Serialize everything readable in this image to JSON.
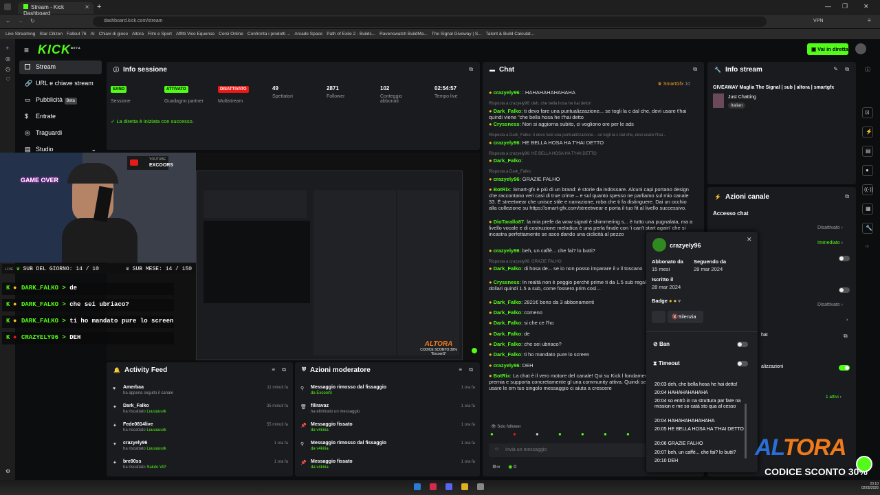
{
  "browser": {
    "tab_title": "Stream - Kick Dashboard",
    "url": "dashboard.kick.com/stream",
    "vpn": "VPN"
  },
  "bookmarks": [
    "Live Streaming",
    "Star Citizen",
    "Fallout 76",
    "AI",
    "Chiavi di gioco",
    "Altora",
    "Film e Sport",
    "Affitti Vico Equense",
    "Corsi Online",
    "Confronta i prodotti ...",
    "Arcade Space",
    "Path of Exile 2 - Builds...",
    "Ravenswatch BuildMa...",
    "The Signal Giveway | S...",
    "Talent & Build Calculat..."
  ],
  "header": {
    "logo": "KICK",
    "beta": "BETA",
    "go_live": "Vai in diretta"
  },
  "sidebar": {
    "items": [
      "Stream",
      "URL e chiave stream",
      "Pubblicità",
      "Entrate",
      "Traguardi",
      "Studio"
    ],
    "beta_badge": "Beta"
  },
  "session": {
    "title": "Info sessione",
    "badges": [
      {
        "label": "SANO",
        "caption": "Sessione"
      },
      {
        "label": "ATTIVATO",
        "caption": "Guadagno partner"
      },
      {
        "label": "DISATTIVATO",
        "caption": "Multistream"
      }
    ],
    "stats": [
      {
        "value": "49",
        "label": "Spettatori"
      },
      {
        "value": "2871",
        "label": "Follower"
      },
      {
        "value": "102",
        "label": "Conteggio abbonati"
      },
      {
        "value": "02:54:57",
        "label": "Tempo live"
      }
    ],
    "success": "La diretta è iniziata con successo."
  },
  "webcam": {
    "yt_label": "YOUTUBE",
    "yt_name": "EXCOORS",
    "game_over": "GAME OVER",
    "sub_day": "SUB DEL GIORNO: 14 / 10",
    "sub_month": "SUB MESE: 14 / 150",
    "live": "LIVE"
  },
  "overlay_chat": [
    {
      "user": "DARK_FALKO",
      "msg": "de"
    },
    {
      "user": "DARK_FALKO",
      "msg": "che sei ubriaco?"
    },
    {
      "user": "DARK_FALKO",
      "msg": "ti ho mandato pure lo screen"
    },
    {
      "user": "CRAZYELY96",
      "msg": "DEH"
    }
  ],
  "chat": {
    "title": "Chat",
    "pinned_user": "SmartGfx",
    "pinned_count": "10",
    "input_placeholder": "Invia un messaggio",
    "followers_only": "Solo follower",
    "count": "0",
    "lines": [
      {
        "user": "crazyely96",
        "msg": ": HAHAHAHAHAHAHA"
      },
      {
        "reply": "Risposta a crazyely96: deh, che bella hosa he hai detto!"
      },
      {
        "user": "Dark_Falko",
        "msg": "ti devo fare una puntualizzazione... se togli la c dal che, devi usare t'hai quindi viene \"che bella hosa he t'hai detto"
      },
      {
        "user": "Cryssness",
        "msg": "Non si aggiorna subito, ci vogliono ore per le ads"
      },
      {
        "reply": "Risposta a Dark_Falko: ti devo fare una puntualizzazione... se togli la c dal che, devi usare t'hai..."
      },
      {
        "user": "crazyely96",
        "msg": "HE BELLA HOSA HA T'HAI DETTO"
      },
      {
        "reply": "Risposta a crazyely96: HE BELLA HOSA HA T'HAI DETTO"
      },
      {
        "user": "Dark_Falko",
        "msg": ""
      },
      {
        "reply": "Risposta a Dark_Falko:"
      },
      {
        "user": "crazyely96",
        "msg": "GRAZIE FALHO"
      },
      {
        "user": "BotRix",
        "msg": "Smart-gfx è più di un brand: è storie da indossare. Alcuni capi portano design che raccontano veri casi di true crime – e sul quanto spesso ne parliamo sul mio canale 33. È streetwear che unisce stile e narrazione, roba che ti fa distinguere. Dai un occhio alla collezione su https://smart-gfx.com/streetwear e porta il tuo fit al livello successivo."
      },
      {
        "user": "DioTarallo87",
        "msg": "la mia prefe da wow signal è shimmering s... è tutto una pugnalata, ma a livello vocale e di costruzione melodica è una perla finale con 'i can't start again' che si incastra perfettamente se asco dando una ciclicità al pezzo"
      },
      {
        "user": "crazyely96",
        "msg": "beh, un caffè... che fai? lo butti?"
      },
      {
        "reply": "Risposta a crazyely96: GRAZIE FALHO"
      },
      {
        "user": "Dark_Falko",
        "msg": "di hosa de... se io non posso imparare il v il toscano"
      },
      {
        "user": "Cryssness",
        "msg": "In realtà non è peggio perchè prime ti da 1.5 sub regalate ho preso 15 dollari quindi 1.5 a sub, come fossero prim così..."
      },
      {
        "user": "Dark_Falko",
        "msg": "2821€ bono da 3 abbonamenti"
      },
      {
        "user": "Dark_Falko",
        "msg": "comeno"
      },
      {
        "user": "Dark_Falko",
        "msg": "si che ce l'ho"
      },
      {
        "user": "Dark_Falko",
        "msg": "de"
      },
      {
        "user": "Dark_Falko",
        "msg": "che sei ubriaco?"
      },
      {
        "user": "Dark_Falko",
        "msg": "ti ho mandato pure lo screen"
      },
      {
        "user": "crazyely96",
        "msg": "DEH"
      },
      {
        "user": "BotRix",
        "msg": "La chat è il vero motore del canale! Qui su Kick l fondamentale: la piattaforma premia e supporta concretamente gl una community attiva. Quindi sentiti libero di scrivere, usare le em tuo singolo messaggio ci aiuta a crescere"
      }
    ]
  },
  "info_stream": {
    "title": "Info stream",
    "stream_title": "GIVEAWAY Maglia The Signal | sub | altora | smartgfx",
    "category": "Just Chatting",
    "language": "Italian"
  },
  "channel_actions": {
    "title": "Azioni canale",
    "access": "Accesso chat",
    "disabled": "Disattivato",
    "immediate": "Immediato",
    "disabled2": "Disattivato",
    "chat_label": "hat",
    "realizations": "alizzazioni",
    "active": "1 attivi"
  },
  "user_card": {
    "name": "crazyely96",
    "subbed_label": "Abbonato da",
    "subbed_value": "15 mesi",
    "following_label": "Seguendo da",
    "following_value": "28 mar 2024",
    "joined_label": "Iscritto il",
    "joined_value": "28 mar 2024",
    "badge_label": "Badge",
    "silence": "Silenzia",
    "ban": "Ban",
    "timeout": "Timeout",
    "log": [
      "20:03 deh, che bella hosa he hai detto!",
      "20:04 HAHAHAHAHAHA",
      "20:04 so entrò in na struttura par fare na mission e me so catà sto qua al cesso",
      "20:04 HAHAHAHAHAHAHA",
      "20:05 HE BELLA HOSA HA T'HAI DETTO",
      "20:06 GRAZIE FALHO",
      "20:07 beh, un caffè... che fai? lo butti?",
      "20:10 DEH"
    ]
  },
  "activity": {
    "title": "Activity Feed",
    "items": [
      {
        "user": "Amerbaa",
        "action": "ha appena seguito il canale",
        "time": "11 minuti fa"
      },
      {
        "user": "Dark_Falko",
        "action": "ha riscattato ",
        "reward": "Luuuuuurk",
        "time": "35 minuti fa"
      },
      {
        "user": "Fede0814live",
        "action": "ha riscattato ",
        "reward": "Luuuuuurk",
        "time": "55 minuti fa"
      },
      {
        "user": "crazyely96",
        "action": "ha riscattato ",
        "reward": "Luuuuuurk",
        "time": "1 ora fa"
      },
      {
        "user": "bre90ss",
        "action": "ha riscattato ",
        "reward": "Saluto VIP",
        "time": "1 ora fa"
      }
    ]
  },
  "mod": {
    "title": "Azioni moderatore",
    "items": [
      {
        "t": "Messaggio rimosso dal fissaggio",
        "s": "da ExcoorS",
        "time": "1 ora fa"
      },
      {
        "t": "filiravaz",
        "s": "ha eliminato un messaggio",
        "time": "1 ora fa"
      },
      {
        "t": "Messaggio fissato",
        "s": "da v4kiria",
        "time": "1 ora fa"
      },
      {
        "t": "Messaggio rimosso dal fissaggio",
        "s": "da v4kiria",
        "time": "1 ora fa"
      },
      {
        "t": "Messaggio fissato",
        "s": "da v4kiria",
        "time": "1 ora fa"
      }
    ]
  },
  "promo": {
    "brand": "ALTORA",
    "code_line": "CODICE SCONTO 30%",
    "code": "“ExcoorS”"
  },
  "taskbar": {
    "time": "20:10",
    "date": "02/05/2026"
  },
  "colors": {
    "kick_green": "#53fc18",
    "panel": "#191b1f",
    "bg": "#0b0d0e",
    "altora_blue": "#2a6fd6",
    "altora_orange": "#f07a1a"
  }
}
